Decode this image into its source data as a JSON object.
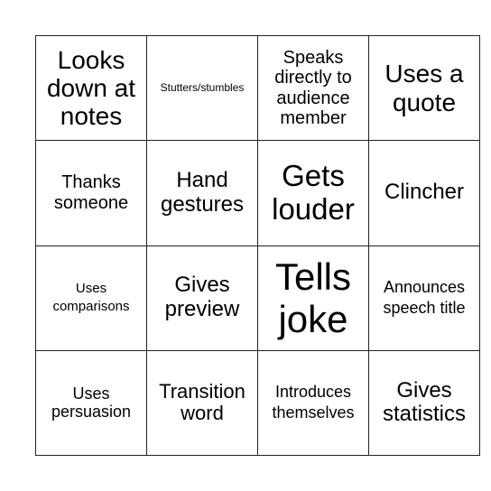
{
  "bingo_card": {
    "rows": [
      [
        "Looks down at notes",
        "Stutters/stumbles",
        "Speaks directly to audience member",
        "Uses a quote"
      ],
      [
        "Thanks someone",
        "Hand gestures",
        "Gets louder",
        "Clincher"
      ],
      [
        "Uses comparisons",
        "Gives preview",
        "Tells joke",
        "Announces speech title"
      ],
      [
        "Uses persuasion",
        "Transition word",
        "Introduces themselves",
        "Gives statistics"
      ]
    ]
  }
}
